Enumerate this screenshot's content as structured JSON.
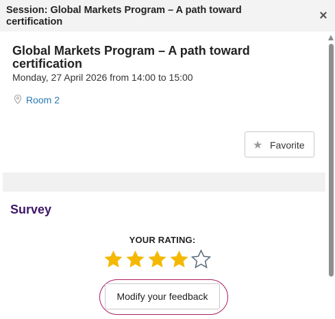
{
  "dialog": {
    "title": "Session: Global Markets Program – A path toward certification",
    "close_symbol": "×"
  },
  "session": {
    "title": "Global Markets Program – A path toward certification",
    "datetime": "Monday, 27 April 2026 from 14:00 to 15:00",
    "room": "Room 2",
    "favorite_label": "Favorite"
  },
  "survey": {
    "heading": "Survey",
    "rating_label": "YOUR RATING:",
    "rating": 4,
    "rating_max": 5,
    "modify_label": "Modify your feedback"
  },
  "colors": {
    "star_filled": "#f5b800",
    "star_empty_outline": "#5a6b7a",
    "survey_heading": "#3d1767",
    "link": "#2a7ab5",
    "focus_ring": "#a8195f"
  },
  "icons": {
    "close": "close-icon",
    "pin": "map-pin-icon",
    "favorite": "star-icon",
    "rating": "star-icon"
  }
}
